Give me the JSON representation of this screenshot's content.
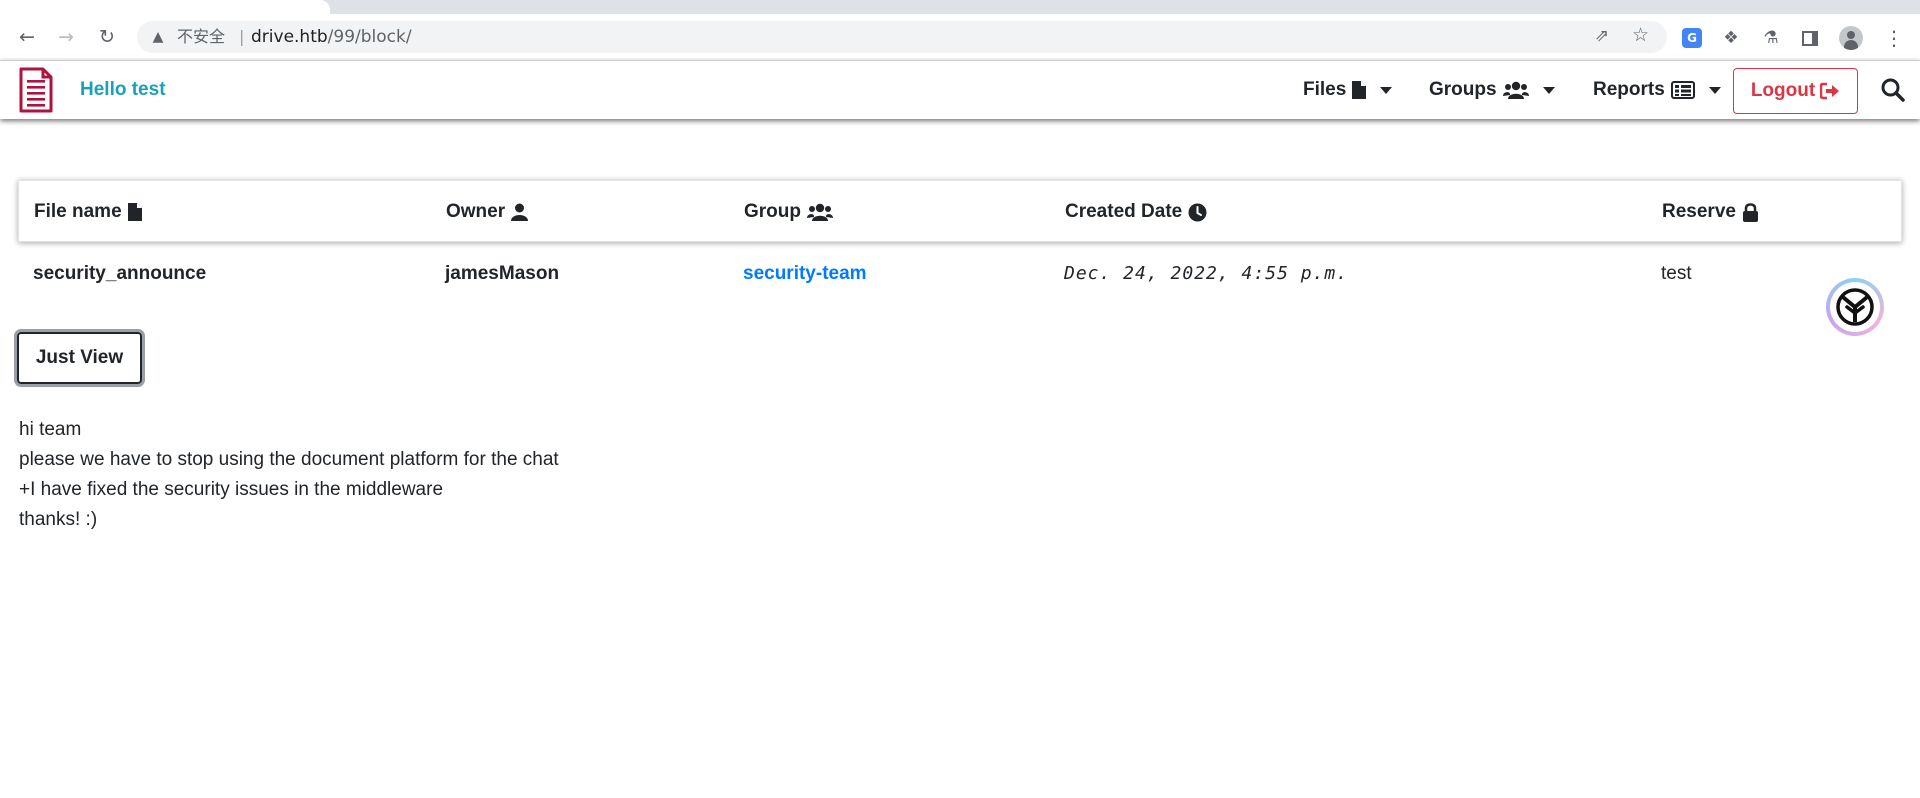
{
  "browser": {
    "security_label": "不安全",
    "url_host": "drive.htb",
    "url_path": "/99/block/",
    "icons": [
      "back-icon",
      "forward-icon",
      "reload-icon",
      "warning-icon",
      "share-icon",
      "star-icon",
      "translate-icon",
      "puzzle-icon",
      "flask-icon",
      "side-panel-icon",
      "profile-icon",
      "kebab-menu-icon"
    ]
  },
  "navbar": {
    "greeting": "Hello test",
    "files_label": "Files",
    "groups_label": "Groups",
    "reports_label": "Reports",
    "logout_label": "Logout",
    "brand_color": "#b0123f",
    "greeting_color": "#17a2b8",
    "logout_color": "#dc3545"
  },
  "table": {
    "headers": [
      {
        "label": "File name",
        "icon": "file-icon"
      },
      {
        "label": "Owner",
        "icon": "user-icon"
      },
      {
        "label": "Group",
        "icon": "users-icon"
      },
      {
        "label": "Created Date",
        "icon": "clock-icon"
      },
      {
        "label": "Reserve",
        "icon": "lock-icon"
      }
    ],
    "row": {
      "file_name": "security_announce",
      "owner": "jamesMason",
      "group": "security-team",
      "created": "Dec. 24, 2022, 4:55 p.m.",
      "reserve": "test"
    },
    "link_color": "#007bff"
  },
  "actions": {
    "just_view_label": "Just View"
  },
  "message": {
    "lines": [
      "hi team",
      "please we have to stop using the document platform for the chat",
      "+I have fixed the security issues in the middleware",
      "thanks! :)"
    ]
  }
}
